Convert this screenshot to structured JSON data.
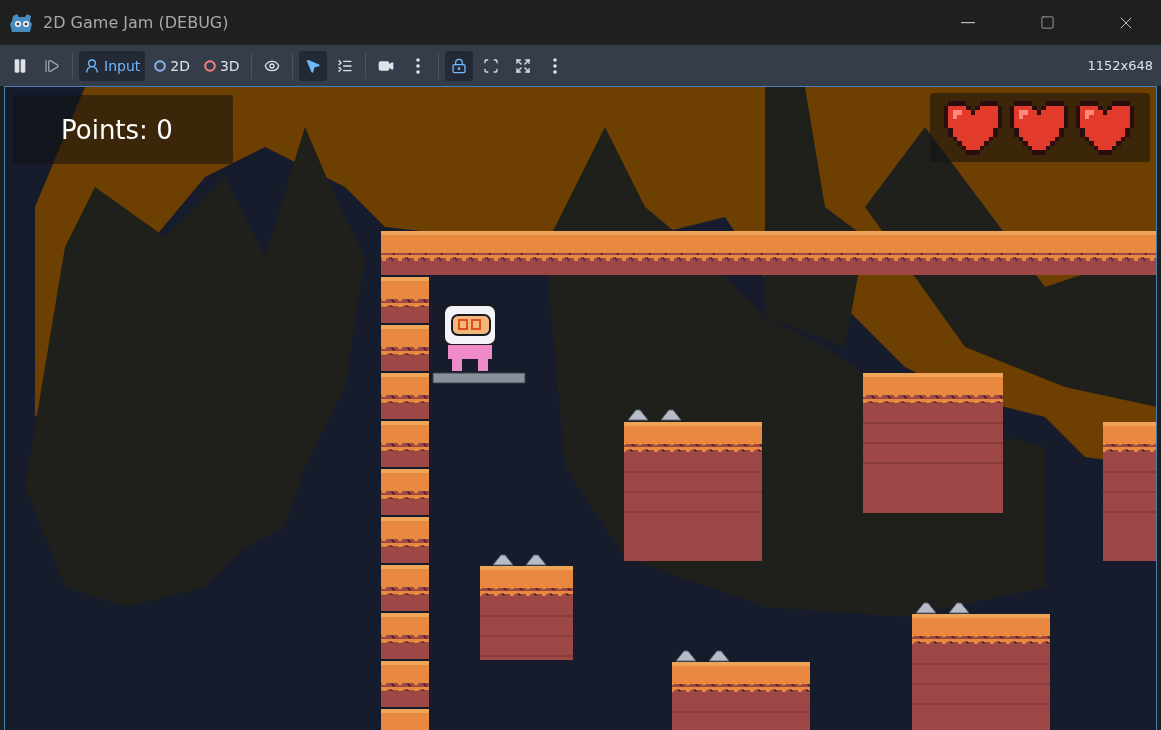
{
  "window": {
    "title": "2D Game Jam (DEBUG)"
  },
  "toolbar": {
    "groups": [
      [
        {
          "kind": "pause",
          "selected": false
        },
        {
          "kind": "step",
          "selected": false
        }
      ],
      [
        {
          "kind": "input",
          "label": "Input",
          "selected": true
        },
        {
          "kind": "mode",
          "label": "2D",
          "color": "#8fb4f0",
          "selected": false
        },
        {
          "kind": "mode",
          "label": "3D",
          "color": "#fc7f7f",
          "selected": false
        }
      ],
      [
        {
          "kind": "eye",
          "selected": false
        }
      ],
      [
        {
          "kind": "pointer",
          "selected": true
        },
        {
          "kind": "list",
          "selected": false
        }
      ],
      [
        {
          "kind": "camera",
          "selected": false
        },
        {
          "kind": "more",
          "selected": false
        }
      ],
      [
        {
          "kind": "lock",
          "selected": true
        },
        {
          "kind": "corners",
          "selected": false
        },
        {
          "kind": "expand",
          "selected": false
        },
        {
          "kind": "more",
          "selected": false
        }
      ]
    ],
    "resolution": "1152x648"
  },
  "hud": {
    "points": "Points: 0",
    "lives": [
      {
        "filled": true
      },
      {
        "filled": true
      },
      {
        "filled": true
      }
    ]
  }
}
